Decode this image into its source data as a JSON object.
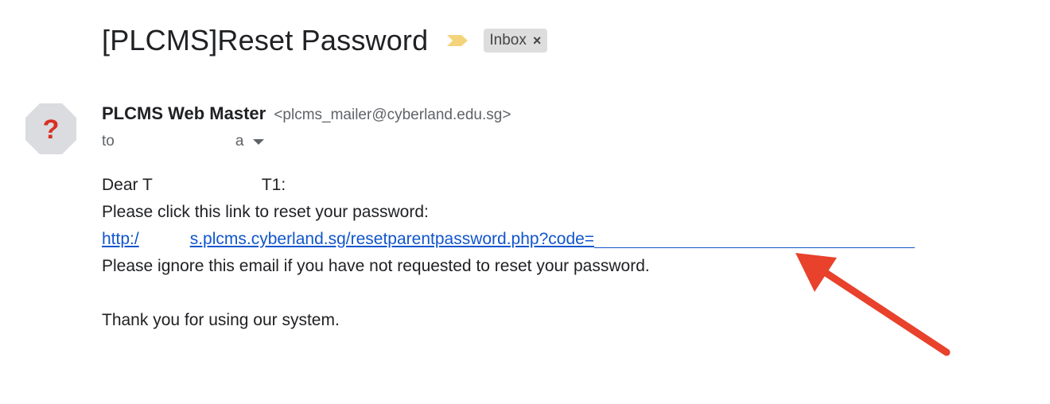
{
  "email": {
    "subject": "[PLCMS]Reset Password",
    "label": "Inbox",
    "label_close": "×",
    "sender_name": "PLCMS Web Master",
    "sender_email": "<plcms_mailer@cyberland.edu.sg>",
    "to_prefix": "to",
    "to_recipient": "a",
    "avatar_glyph": "?",
    "body": {
      "greeting_start": "Dear T",
      "greeting_end": "T1:",
      "instruction": "Please click this link to reset your password:",
      "link_start": "http:/",
      "link_visible": "s.plcms.cyberland.sg/resetparentpassword.php?code=",
      "ignore_note": "Please ignore this email if you have not requested to reset your password.",
      "thanks": "Thank you for using our system."
    }
  },
  "colors": {
    "link": "#1155cc",
    "arrow": "#e8412c",
    "important_marker": "#f4d47a",
    "avatar_bg": "#dadce0",
    "avatar_glyph": "#d93025"
  },
  "icons": {
    "important": "important-marker-icon",
    "avatar": "unknown-sender-avatar-icon",
    "dropdown": "chevron-down-icon",
    "arrow": "annotation-arrow-icon"
  }
}
